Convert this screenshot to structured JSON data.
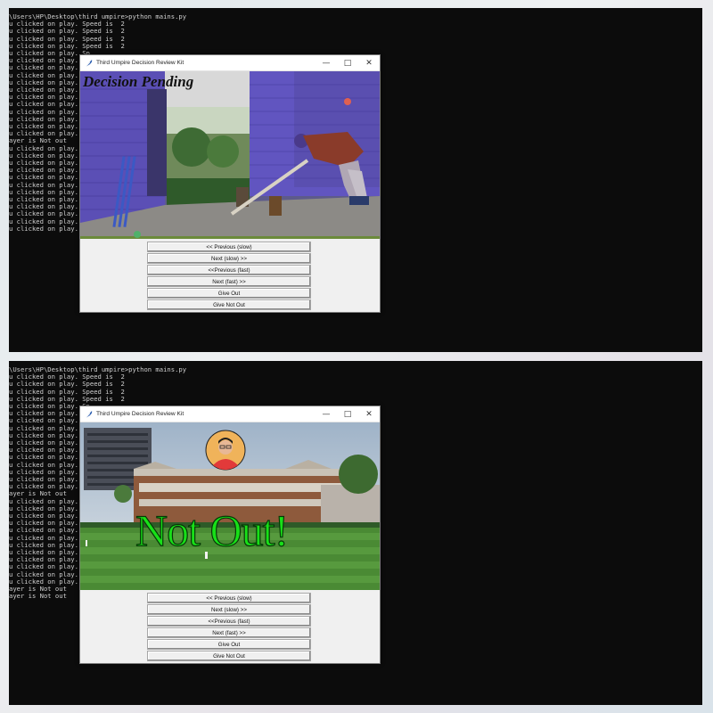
{
  "top": {
    "console_lines": [
      "\\Users\\HP\\Desktop\\third umpire>python mains.py",
      "u clicked on play. Speed is  2",
      "u clicked on play. Speed is  2",
      "u clicked on play. Speed is  2",
      "u clicked on play. Speed is  2",
      "u clicked on play. Sp",
      "u clicked on play. Sp",
      "u clicked on play. Sp",
      "u clicked on play. Sp",
      "u clicked on play. Sp",
      "u clicked on play. Sp",
      "u clicked on play. Sp",
      "u clicked on play. Sp",
      "u clicked on play. Sp",
      "u clicked on play. Sp",
      "u clicked on play. Sp",
      "u clicked on play. Sp",
      "ayer is Not out",
      "u clicked on play. Sp",
      "u clicked on play. Sp",
      "u clicked on play. Sp",
      "u clicked on play. Sp",
      "u clicked on play. Sp",
      "u clicked on play. Sp",
      "u clicked on play. Sp",
      "u clicked on play. Sp",
      "u clicked on play. Sp",
      "u clicked on play. Sp",
      "u clicked on play. Sp",
      "u clicked on play. Sp"
    ],
    "window_title": "Third Umpire Decision Review Kit",
    "overlay_text": "Decision Pending"
  },
  "bottom": {
    "console_lines": [
      "\\Users\\HP\\Desktop\\third umpire>python mains.py",
      "u clicked on play. Speed is  2",
      "u clicked on play. Speed is  2",
      "u clicked on play. Speed is  2",
      "u clicked on play. Speed is  2",
      "u clicked on play. Sp",
      "u clicked on play. Sp",
      "u clicked on play. Sp",
      "u clicked on play. Sp",
      "u clicked on play. Sp",
      "u clicked on play. Sp",
      "u clicked on play. Sp",
      "u clicked on play. Sp",
      "u clicked on play. Sp",
      "u clicked on play. Sp",
      "u clicked on play. Sp",
      "u clicked on play. Sp",
      "ayer is Not out",
      "u clicked on play. Sp",
      "u clicked on play. Sp",
      "u clicked on play. Sp",
      "u clicked on play. Sp",
      "u clicked on play. Sp",
      "u clicked on play. Sp",
      "u clicked on play. Sp",
      "u clicked on play. Sp",
      "u clicked on play. Sp",
      "u clicked on play. Sp",
      "u clicked on play. Sp",
      "u clicked on play. Sp",
      "ayer is Not out",
      "ayer is Not out"
    ],
    "window_title": "Third Umpire Decision Review Kit",
    "overlay_text": "Not Out!"
  },
  "buttons": {
    "prev_slow": "<< Previous (slow)",
    "next_slow": "Next (slow) >>",
    "prev_fast": "<<Previous (fast)",
    "next_fast": "Next (fast) >>",
    "give_out": "Give Out",
    "give_not_out": "Give Not Out"
  },
  "window_controls": {
    "minimize": "—",
    "maximize": "□",
    "close": "✕"
  },
  "colors": {
    "console_bg": "#0c0c0c",
    "console_text": "#cfcfcf",
    "not_out_green": "#18e018",
    "tk_bg": "#f0f0f0"
  },
  "icons": [
    "feather-icon",
    "minimize-icon",
    "maximize-icon",
    "close-icon"
  ]
}
